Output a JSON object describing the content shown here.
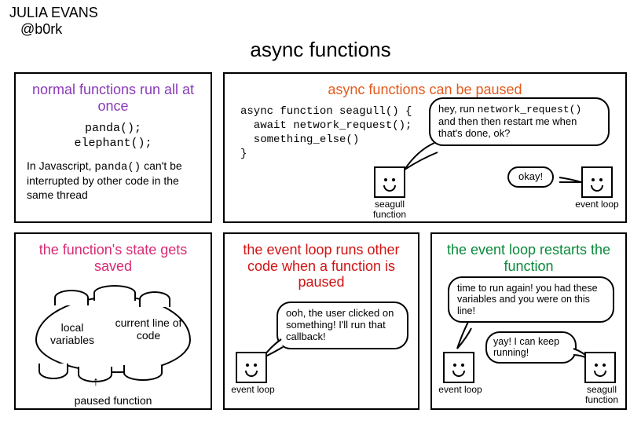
{
  "author": {
    "name": "JULIA EVANS",
    "handle": "@b0rk"
  },
  "title": "async functions",
  "panel1": {
    "title": "normal functions run all at once",
    "code1": "panda();",
    "code2": "elephant();",
    "note_pre": "In Javascript, ",
    "note_code": "panda()",
    "note_post": " can't be interrupted by other code in the same thread"
  },
  "panel2": {
    "title": "async functions can be paused",
    "code": "async function seagull() {\n  await network_request();\n  something_else()\n}",
    "bubble_pre": "hey, run ",
    "bubble_code": "network_request()",
    "bubble_post": " and then then restart me when that's done, ok?",
    "reply": "okay!",
    "char1": "seagull function",
    "char2": "event loop"
  },
  "panel3": {
    "title": "the function's state gets saved",
    "cloud_left": "local variables",
    "cloud_right": "current line of code",
    "caption": "paused function"
  },
  "panel4": {
    "title": "the event loop runs other code when a function is paused",
    "bubble": "ooh, the user clicked on something! I'll run that callback!",
    "char": "event loop"
  },
  "panel5": {
    "title": "the event loop restarts the function",
    "bubble1": "time to run again! you had these variables and you were on this line!",
    "bubble2": "yay! I can keep running!",
    "char1": "event loop",
    "char2": "seagull function"
  }
}
